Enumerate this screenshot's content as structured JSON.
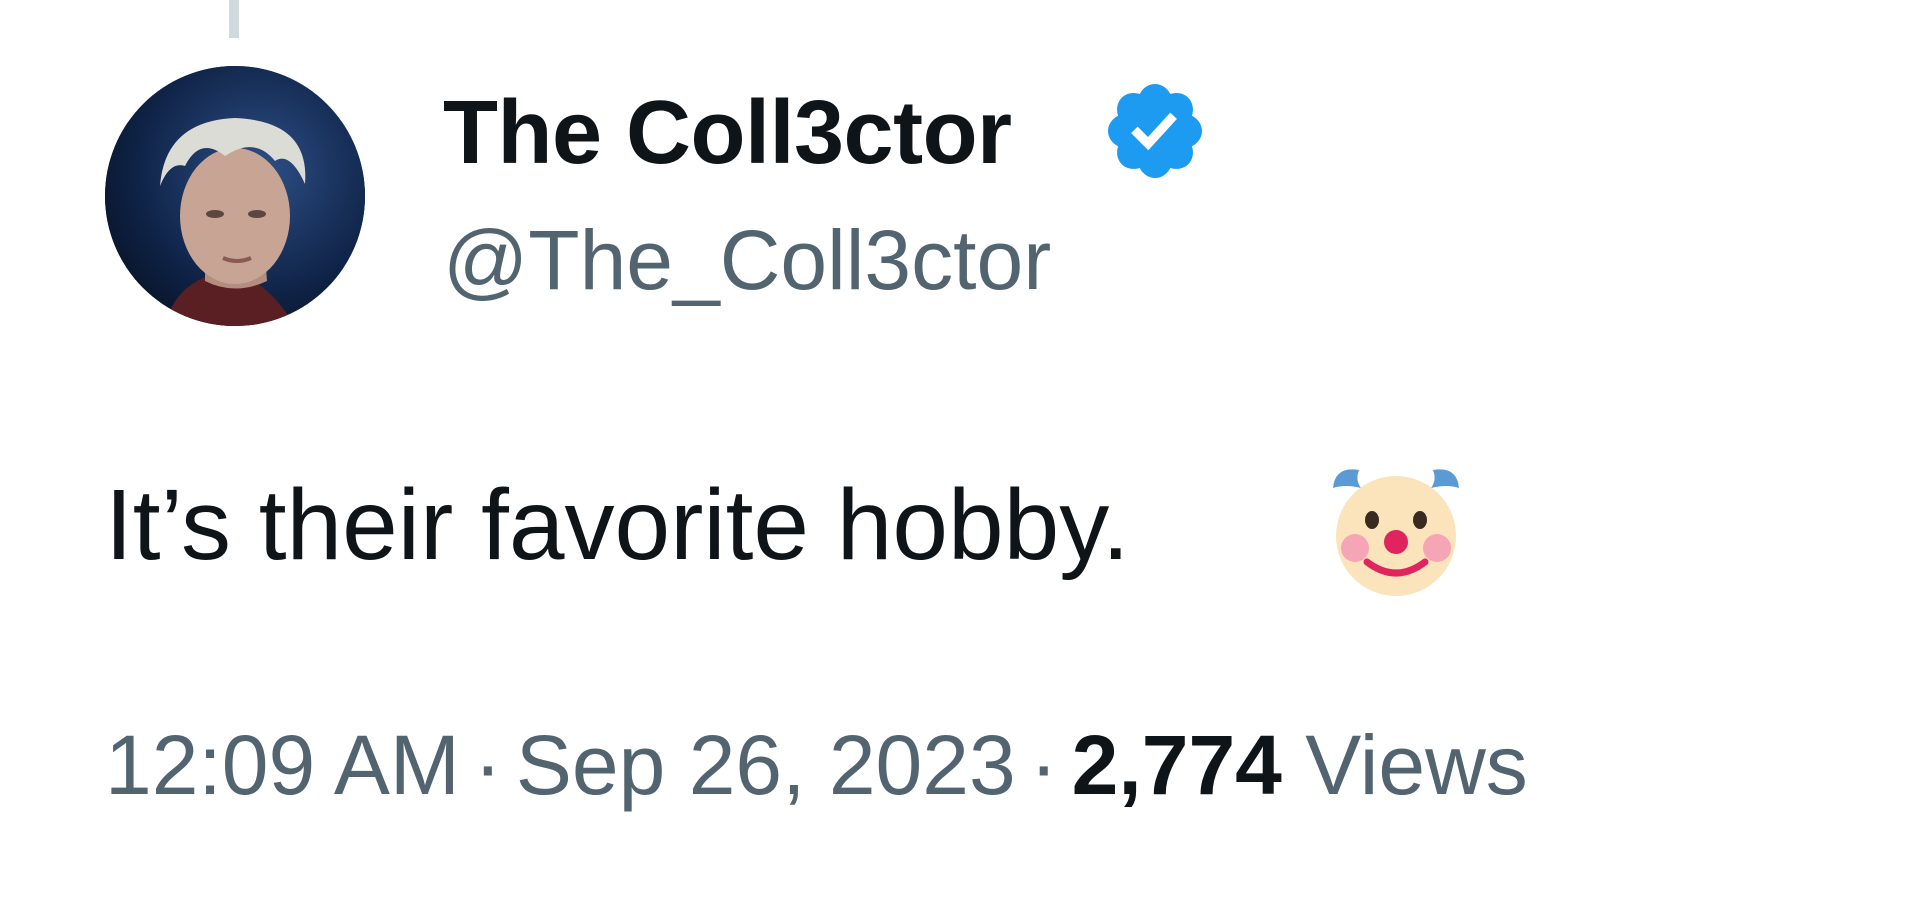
{
  "tweet": {
    "author_name": "The Coll3ctor",
    "author_handle": "@The_Coll3ctor",
    "verified": true,
    "text": "It’s their favorite hobby.",
    "emoji": "clown-face-icon",
    "time": "12:09 AM",
    "date": "Sep 26, 2023",
    "separator": "·",
    "views_count": "2,774",
    "views_label": "Views"
  },
  "colors": {
    "primary_text": "#0f1419",
    "secondary_text": "#536471",
    "verified_blue": "#1d9bf0",
    "thread_line": "#cfd9de"
  }
}
